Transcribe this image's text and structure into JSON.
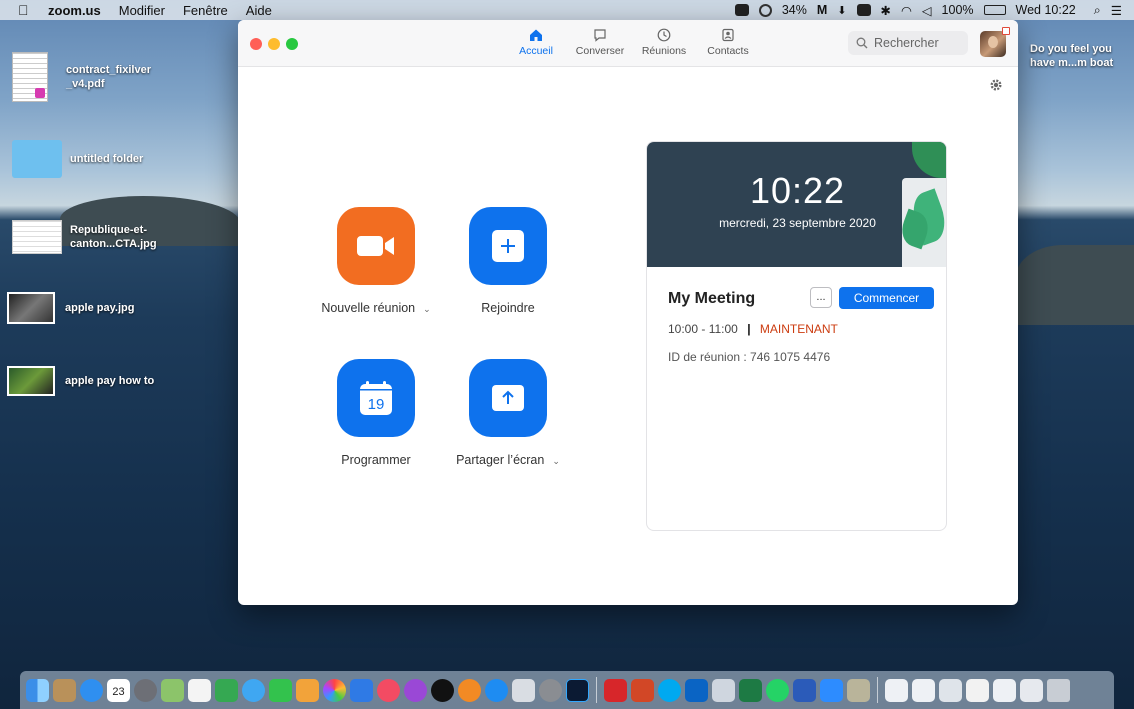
{
  "menubar": {
    "app": "zoom.us",
    "menus": [
      "Modifier",
      "Fenêtre",
      "Aide"
    ],
    "battery_small": "34%",
    "battery": "100%",
    "clock": "Wed 10:22"
  },
  "desktop": {
    "files": [
      {
        "label": "contract_fixilver _v4.pdf"
      },
      {
        "label": "untitled folder"
      },
      {
        "label": "Republique-et-canton...CTA.jpg"
      },
      {
        "label": "apple pay.jpg"
      },
      {
        "label": "apple pay how to"
      }
    ],
    "notification": "Do you feel you have m...m boat"
  },
  "zoom": {
    "tabs": [
      {
        "label": "Accueil",
        "icon": "home-icon",
        "active": true
      },
      {
        "label": "Converser",
        "icon": "chat-icon"
      },
      {
        "label": "Réunions",
        "icon": "clock-icon"
      },
      {
        "label": "Contacts",
        "icon": "contacts-icon"
      }
    ],
    "search_placeholder": "Rechercher",
    "actions": [
      {
        "label": "Nouvelle réunion",
        "icon": "video-camera-icon",
        "color": "#f26d21",
        "has_dropdown": true
      },
      {
        "label": "Rejoindre",
        "icon": "plus-icon",
        "color": "#0e72ed",
        "has_dropdown": false
      },
      {
        "label": "Programmer",
        "icon": "calendar-icon",
        "calendar_day": "19",
        "color": "#0e72ed",
        "has_dropdown": false
      },
      {
        "label": "Partager l’écran",
        "icon": "share-arrow-up-icon",
        "color": "#0e72ed",
        "has_dropdown": true
      }
    ],
    "card": {
      "time": "10:22",
      "date": "mercredi, 23 septembre 2020",
      "meeting_title": "My Meeting",
      "more_label": "...",
      "start_label": "Commencer",
      "time_range": "10:00 - 11:00",
      "separator": "|",
      "status": "MAINTENANT",
      "meeting_id": "ID de réunion : 746 1075 4476"
    }
  },
  "dock": {
    "calendar_day": "23"
  }
}
